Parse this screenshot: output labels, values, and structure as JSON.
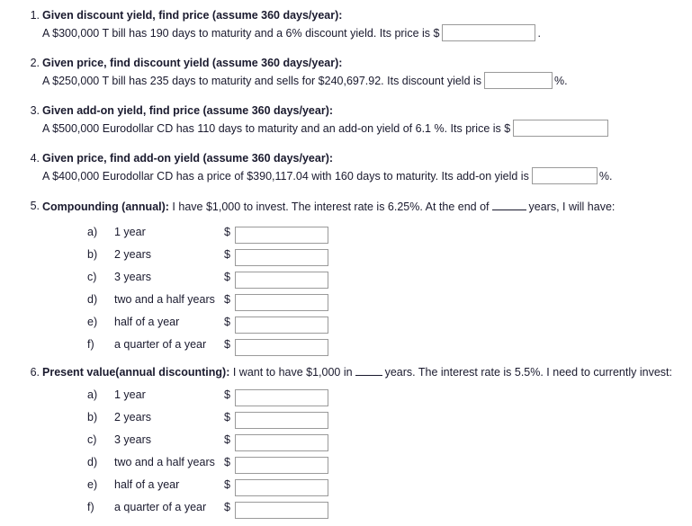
{
  "document": {
    "type": "finance-worksheet",
    "background": "#ffffff",
    "text_color": "#1a1a2e",
    "input_border_color": "#9a9a9a"
  },
  "questions": [
    {
      "number": "1.",
      "title": "Given discount yield, find price (assume 360 days/year):",
      "body_before": "A $300,000 T bill has 190 days to maturity and a 6% discount yield. Its price is $",
      "input_value": "",
      "input_placeholder": "",
      "body_after": "."
    },
    {
      "number": "2.",
      "title": "Given price, find discount yield (assume 360 days/year):",
      "body_before": "A $250,000 T bill has 235 days to maturity and sells for $240,697.92. Its discount yield is",
      "input_value": "",
      "input_placeholder": "",
      "body_after": "%."
    },
    {
      "number": "3.",
      "title": "Given add-on yield, find price (assume 360 days/year):",
      "body_before": "A $500,000 Eurodollar CD has 110 days to maturity and an add-on yield of 6.1 %. Its price is $",
      "input_value": "",
      "input_placeholder": "",
      "body_after": ""
    },
    {
      "number": "4.",
      "title": "Given price, find add-on yield (assume 360 days/year):",
      "body_before": "A $400,000 Eurodollar CD has a price of $390,117.04 with 160 days to maturity. Its add-on yield is",
      "input_value": "",
      "input_placeholder": "",
      "body_after": "%."
    }
  ],
  "question5": {
    "number": "5.",
    "heading": "Compounding (annual):",
    "text_before_blank": " I have $1,000 to invest. The interest rate is 6.25%. At the end of",
    "text_after_blank": "years, I will have:",
    "dollar_sign": "$",
    "items": [
      {
        "letter": "a)",
        "label": "1 year",
        "value": ""
      },
      {
        "letter": "b)",
        "label": "2 years",
        "value": ""
      },
      {
        "letter": "c)",
        "label": "3 years",
        "value": ""
      },
      {
        "letter": "d)",
        "label": "two and a half years",
        "value": ""
      },
      {
        "letter": "e)",
        "label": "half of a year",
        "value": ""
      },
      {
        "letter": "f)",
        "label": "a quarter of a year",
        "value": ""
      }
    ]
  },
  "question6": {
    "number": "6.",
    "heading": "Present value(annual discounting):",
    "text_before_blank": " I want to have $1,000 in",
    "text_after_blank": "years. The interest rate is 5.5%. I need to currently invest:",
    "dollar_sign": "$",
    "items": [
      {
        "letter": "a)",
        "label": "1 year",
        "value": ""
      },
      {
        "letter": "b)",
        "label": "2 years",
        "value": ""
      },
      {
        "letter": "c)",
        "label": "3 years",
        "value": ""
      },
      {
        "letter": "d)",
        "label": "two and a half years",
        "value": ""
      },
      {
        "letter": "e)",
        "label": "half of a year",
        "value": ""
      },
      {
        "letter": "f)",
        "label": "a quarter of a year",
        "value": ""
      }
    ]
  }
}
